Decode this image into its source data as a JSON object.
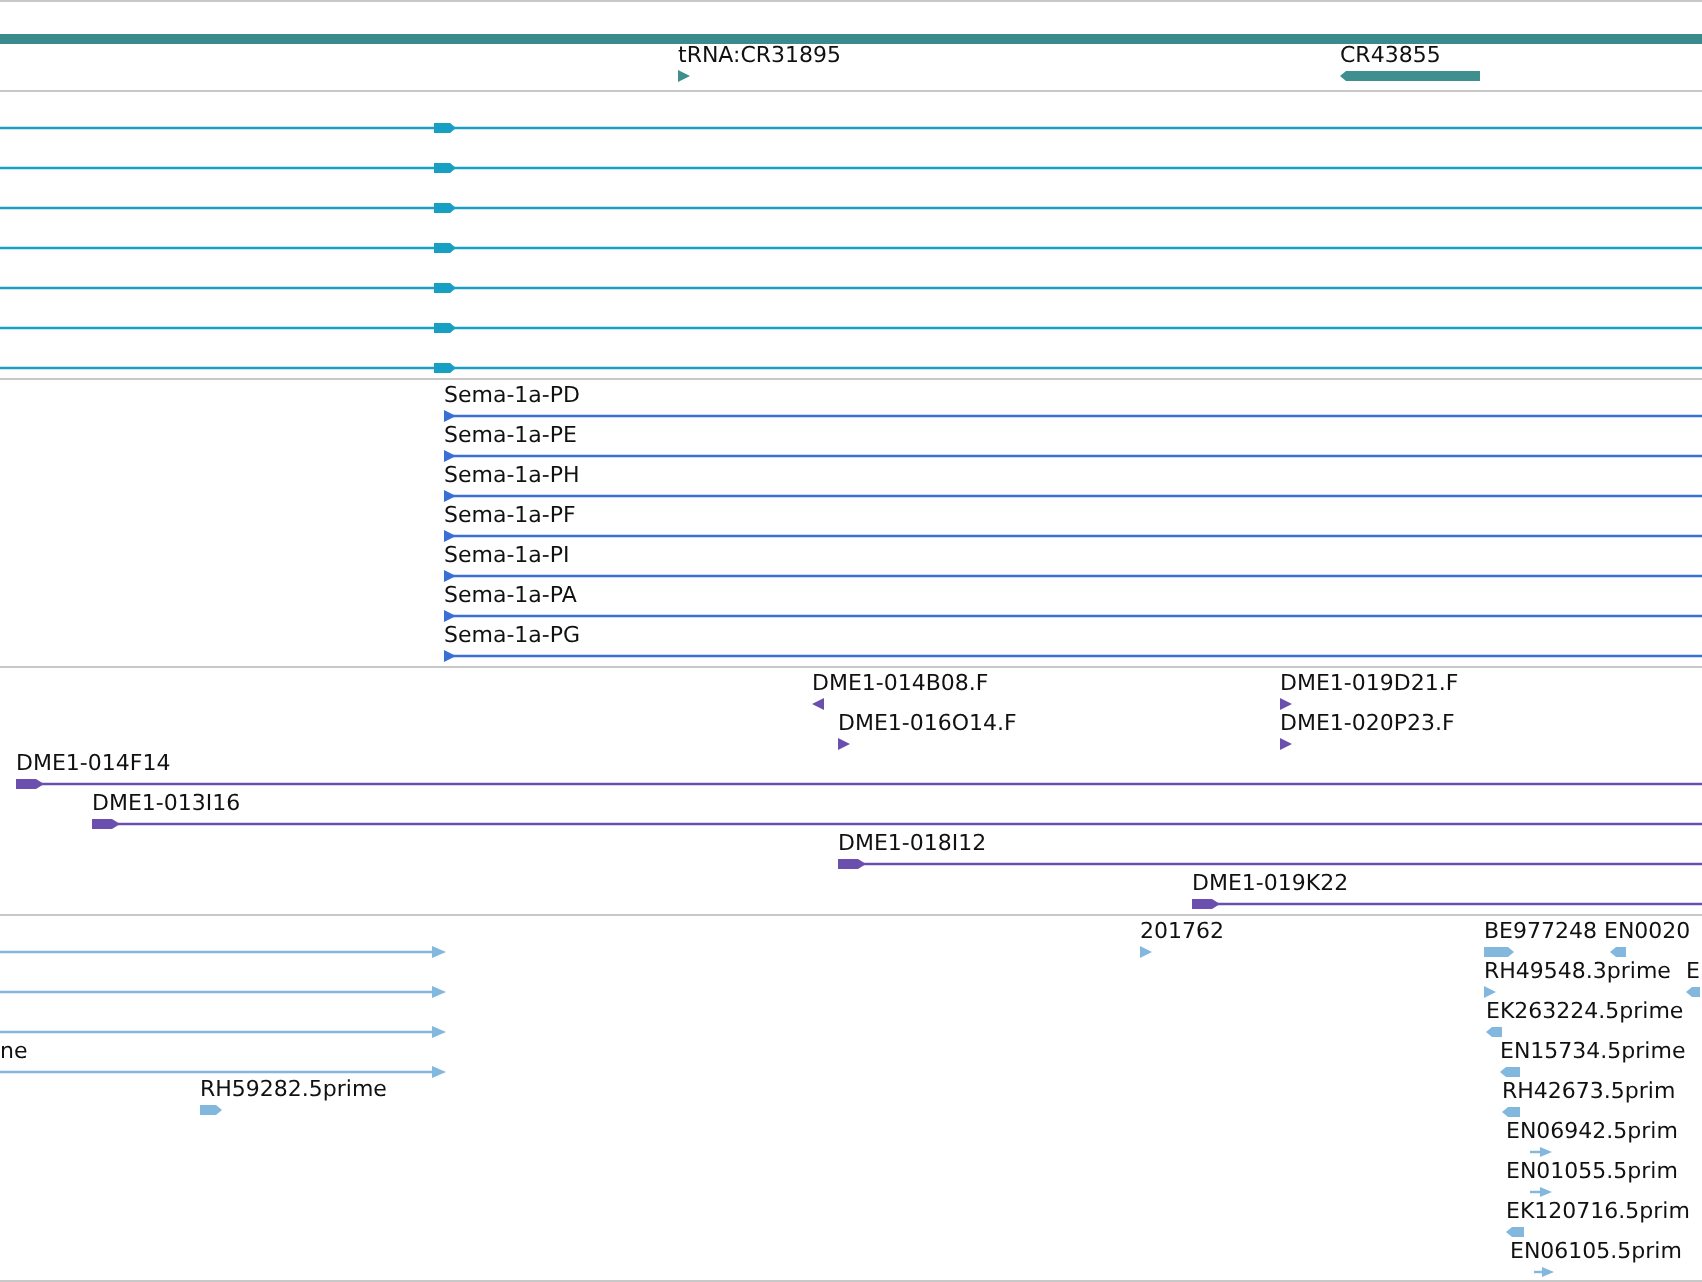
{
  "tracks": [
    {
      "kind": "gene",
      "features": [
        {
          "label": "tRNA:CR31895",
          "reverse": false
        },
        {
          "label": "CR43855",
          "reverse": true
        }
      ]
    },
    {
      "kind": "transcript",
      "features": [
        {
          "reverse": false
        },
        {
          "reverse": false
        },
        {
          "reverse": false
        },
        {
          "reverse": false
        },
        {
          "reverse": false
        },
        {
          "reverse": false
        },
        {
          "reverse": false
        }
      ]
    },
    {
      "kind": "mrna",
      "features": [
        {
          "label": "Sema-1a-PD",
          "reverse": false
        },
        {
          "label": "Sema-1a-PE",
          "reverse": false
        },
        {
          "label": "Sema-1a-PH",
          "reverse": false
        },
        {
          "label": "Sema-1a-PF",
          "reverse": false
        },
        {
          "label": "Sema-1a-PI",
          "reverse": false
        },
        {
          "label": "Sema-1a-PA",
          "reverse": false
        },
        {
          "label": "Sema-1a-PG",
          "reverse": false
        }
      ]
    },
    {
      "kind": "clone",
      "features": [
        {
          "label": "DME1-014B08.F",
          "reverse": true
        },
        {
          "label": "DME1-019D21.F",
          "reverse": false
        },
        {
          "label": "DME1-016O14.F",
          "reverse": false
        },
        {
          "label": "DME1-020P23.F",
          "reverse": false
        },
        {
          "label": "DME1-014F14",
          "reverse": false
        },
        {
          "label": "DME1-013I16",
          "reverse": false
        },
        {
          "label": "DME1-018I12",
          "reverse": false
        },
        {
          "label": "DME1-019K22",
          "reverse": false
        }
      ]
    },
    {
      "kind": "est",
      "features": [
        {
          "reverse": false
        },
        {
          "reverse": false
        },
        {
          "reverse": false
        },
        {
          "label": "ne",
          "reverse": false
        },
        {
          "label": "RH59282.5prime",
          "reverse": false
        },
        {
          "label": "201762",
          "reverse": false
        },
        {
          "label": "BE977248",
          "reverse": false
        },
        {
          "label": "EN0020",
          "reverse": true
        },
        {
          "label": "RH49548.3prime",
          "reverse": false
        },
        {
          "label": "E",
          "reverse": true
        },
        {
          "label": "EK263224.5prime",
          "reverse": true
        },
        {
          "label": "EN15734.5prime",
          "reverse": true
        },
        {
          "label": "RH42673.5prim",
          "reverse": true
        },
        {
          "label": "EN06942.5prim",
          "reverse": false
        },
        {
          "label": "EN01055.5prim",
          "reverse": false
        },
        {
          "label": "EK120716.5prim",
          "reverse": true
        },
        {
          "label": "EN06105.5prim",
          "reverse": false
        }
      ]
    }
  ]
}
